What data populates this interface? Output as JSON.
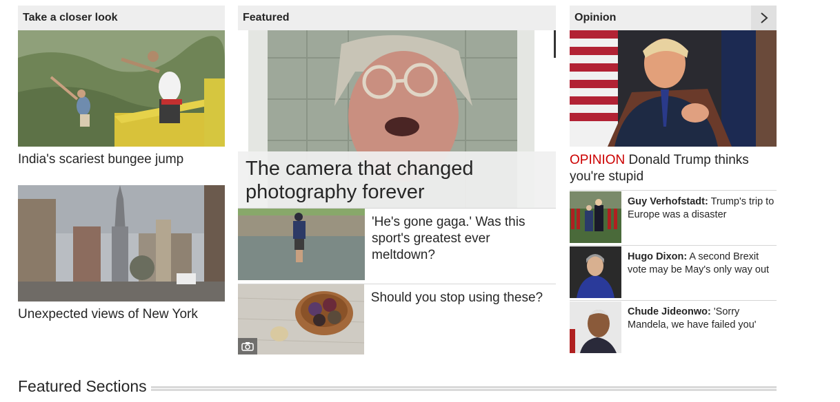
{
  "left_column": {
    "header": "Take a closer look",
    "cards": [
      {
        "headline": "India's scariest bungee jump"
      },
      {
        "headline": "Unexpected views of New York"
      }
    ]
  },
  "featured_column": {
    "header": "Featured",
    "hero_headline": "The camera that changed photography forever",
    "items": [
      {
        "headline": "'He's gone gaga.' Was this sport's greatest ever meltdown?"
      },
      {
        "headline": "Should you stop using these?",
        "media_icon": "camera-icon"
      }
    ]
  },
  "opinion_column": {
    "header": "Opinion",
    "next_icon": "chevron-right-icon",
    "main": {
      "kicker": "OPINION",
      "headline": "Donald Trump thinks you're stupid"
    },
    "items": [
      {
        "author": "Guy Verhofstadt:",
        "text": "Trump's trip to Europe was a disaster"
      },
      {
        "author": "Hugo Dixon:",
        "text": "A second Brexit vote may be May's only way out"
      },
      {
        "author": "Chude Jideonwo:",
        "text": "'Sorry Mandela, we have failed you'"
      }
    ]
  },
  "featured_sections": {
    "title": "Featured Sections"
  },
  "colors": {
    "header_bg": "#eeeeee",
    "opinion_red": "#cc0000",
    "divider": "#d5d5d5",
    "text": "#262626"
  }
}
